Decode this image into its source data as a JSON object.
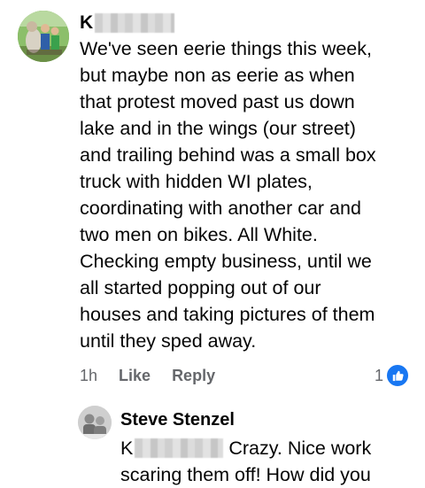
{
  "comment": {
    "author_initial": "K",
    "lines": [
      "We've seen eerie things this week,",
      "but maybe non as eerie as when",
      "that protest moved past us down",
      "lake and in the wings (our street)",
      "and trailing behind was a small box",
      "truck with hidden WI plates,",
      "coordinating with another car and",
      "two men on bikes. All White.",
      "Checking empty business, until we",
      "all started popping out of our",
      "houses and taking pictures of them",
      "until they sped away."
    ],
    "time": "1h",
    "like_label": "Like",
    "reply_label": "Reply",
    "reaction_count": "1"
  },
  "reply": {
    "author": "Steve Stenzel",
    "mention_initial": "K",
    "text_after_mention": "Crazy. Nice work",
    "line2": "scaring them off! How did you"
  },
  "colors": {
    "accent": "#1877f2",
    "meta_text": "#65676b",
    "text": "#050505"
  }
}
